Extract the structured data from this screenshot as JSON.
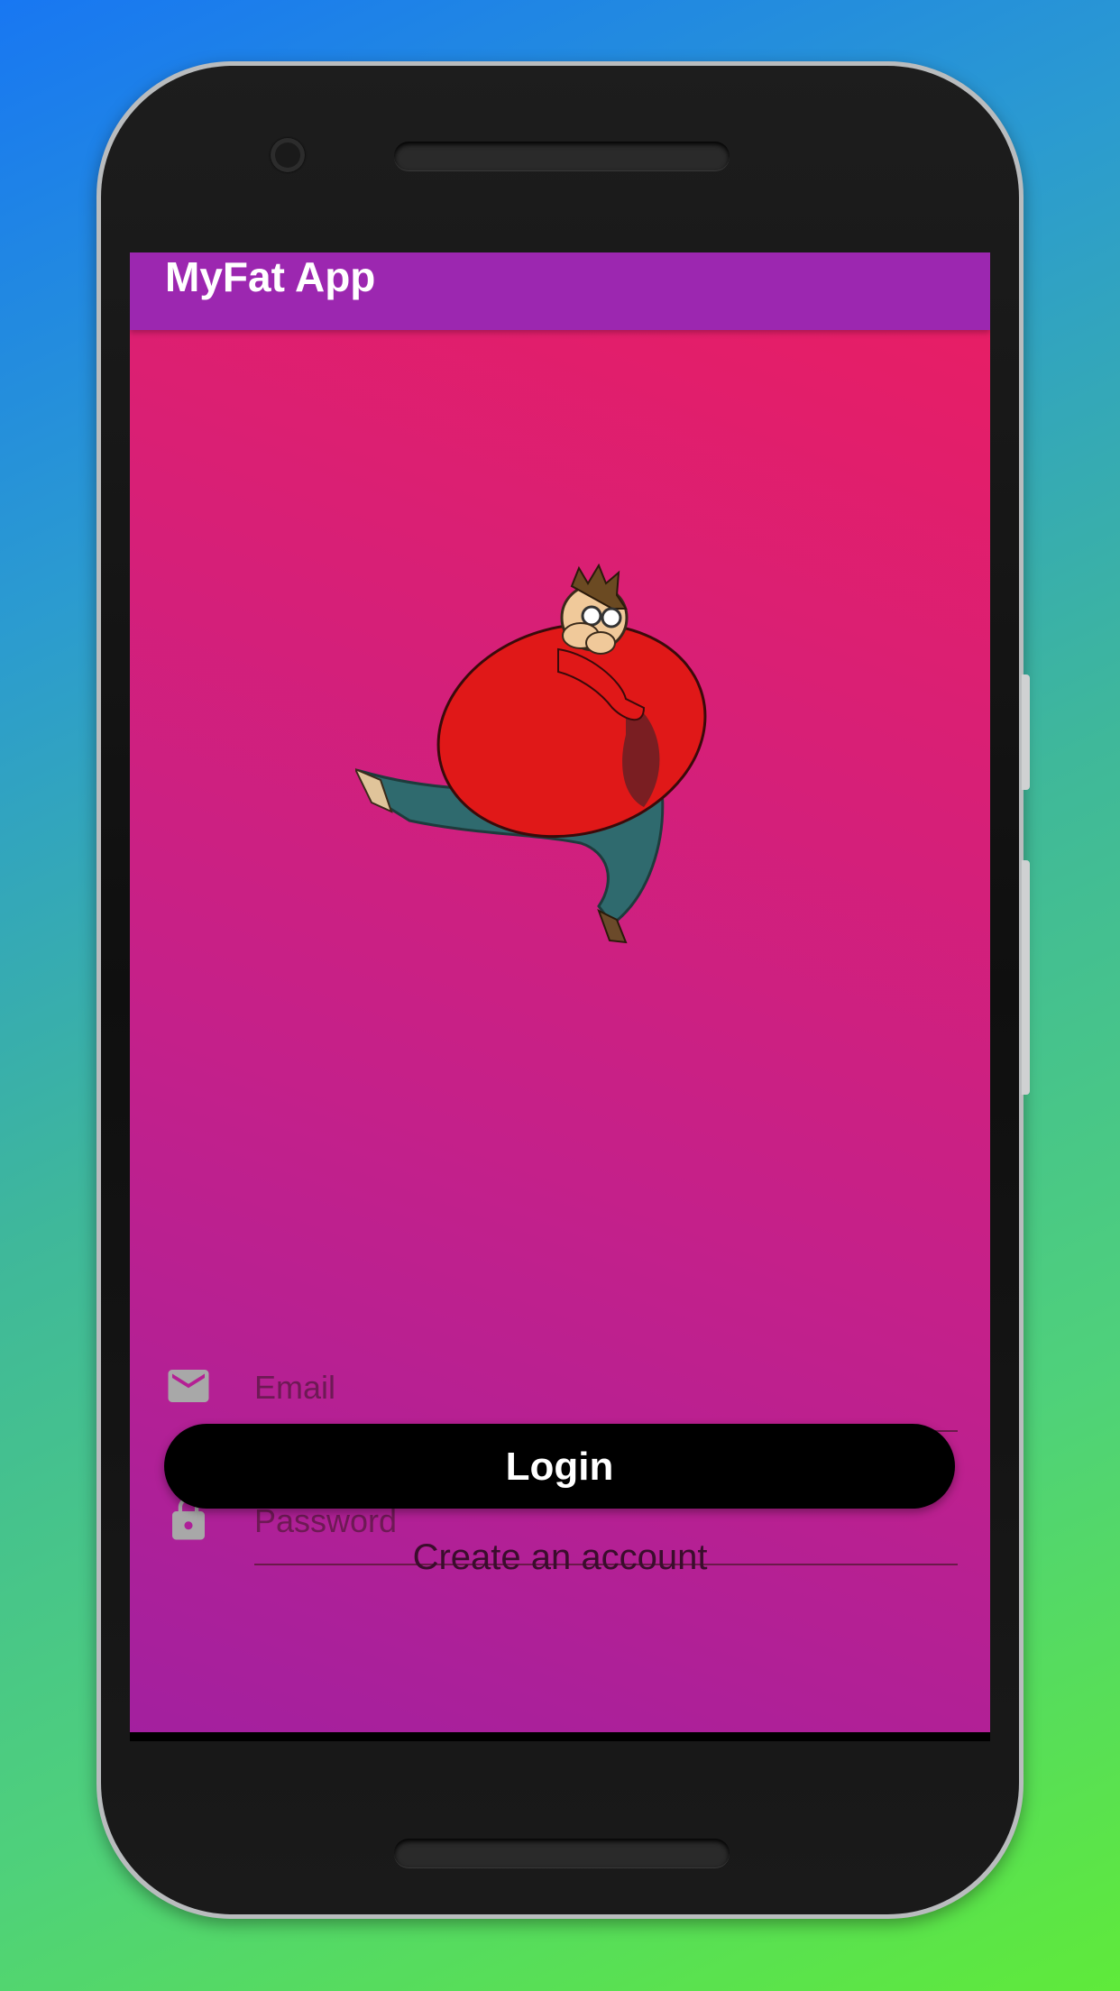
{
  "app": {
    "title": "MyFat App"
  },
  "form": {
    "email_placeholder": "Email",
    "password_placeholder": "Password",
    "email_icon": "mail-icon",
    "password_icon": "lock-icon"
  },
  "actions": {
    "login_label": "Login",
    "create_account_label": "Create an account"
  },
  "colors": {
    "appbar": "#9c27b0",
    "gradient_top": "#e91e63",
    "gradient_bottom": "#9c27b0",
    "button": "#000000"
  }
}
